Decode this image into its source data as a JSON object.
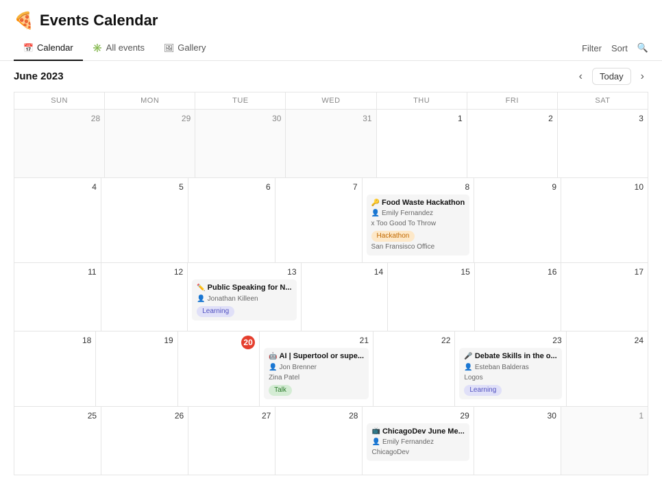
{
  "app": {
    "title": "Events Calendar",
    "logo": "🍕"
  },
  "tabs": {
    "items": [
      {
        "id": "calendar",
        "label": "Calendar",
        "icon": "📅",
        "active": true
      },
      {
        "id": "all-events",
        "label": "All events",
        "icon": "✳️",
        "active": false
      },
      {
        "id": "gallery",
        "label": "Gallery",
        "icon": "🖼",
        "active": false
      }
    ],
    "filter_label": "Filter",
    "sort_label": "Sort",
    "search_icon": "🔍"
  },
  "calendar": {
    "month_year": "June 2023",
    "today_label": "Today",
    "day_headers": [
      "Sun",
      "Mon",
      "Tue",
      "Wed",
      "Thu",
      "Fri",
      "Sat"
    ],
    "weeks": [
      {
        "days": [
          {
            "num": "28",
            "other_month": true,
            "events": []
          },
          {
            "num": "29",
            "other_month": true,
            "events": []
          },
          {
            "num": "30",
            "other_month": true,
            "events": []
          },
          {
            "num": "31",
            "other_month": true,
            "events": []
          },
          {
            "num": "Jun 1",
            "display_num": "1",
            "other_month": false,
            "events": []
          },
          {
            "num": "2",
            "other_month": false,
            "events": []
          },
          {
            "num": "3",
            "other_month": false,
            "events": []
          }
        ]
      },
      {
        "days": [
          {
            "num": "4",
            "other_month": false,
            "events": []
          },
          {
            "num": "5",
            "other_month": false,
            "events": []
          },
          {
            "num": "6",
            "other_month": false,
            "events": []
          },
          {
            "num": "7",
            "other_month": false,
            "events": []
          },
          {
            "num": "8",
            "other_month": false,
            "events": [
              {
                "title": "Food Waste Hackathon",
                "icon": "🔑",
                "organizer": "Emily Fernandez",
                "organizer_icon": "👤",
                "secondary": "x Too Good To Throw",
                "tag": "Hackathon",
                "tag_class": "tag-hackathon",
                "location": "San Fransisco Office"
              }
            ]
          },
          {
            "num": "9",
            "other_month": false,
            "events": []
          },
          {
            "num": "10",
            "other_month": false,
            "events": []
          }
        ]
      },
      {
        "days": [
          {
            "num": "11",
            "other_month": false,
            "events": []
          },
          {
            "num": "12",
            "other_month": false,
            "events": []
          },
          {
            "num": "13",
            "other_month": false,
            "events": [
              {
                "title": "Public Speaking for N...",
                "icon": "✏️",
                "organizer": "Jonathan Killeen",
                "organizer_icon": "👤",
                "tag": "Learning",
                "tag_class": "tag-learning"
              }
            ]
          },
          {
            "num": "14",
            "other_month": false,
            "events": []
          },
          {
            "num": "15",
            "other_month": false,
            "events": []
          },
          {
            "num": "16",
            "other_month": false,
            "events": []
          },
          {
            "num": "17",
            "other_month": false,
            "events": []
          }
        ]
      },
      {
        "days": [
          {
            "num": "18",
            "other_month": false,
            "events": []
          },
          {
            "num": "19",
            "other_month": false,
            "events": []
          },
          {
            "num": "20",
            "today": true,
            "other_month": false,
            "events": []
          },
          {
            "num": "21",
            "other_month": false,
            "events": [
              {
                "title": "AI | Supertool or supe...",
                "icon": "🤖",
                "organizer": "Jon Brenner",
                "organizer_icon": "👤",
                "secondary": "Zina Patel",
                "tag": "Talk",
                "tag_class": "tag-talk"
              }
            ]
          },
          {
            "num": "22",
            "other_month": false,
            "events": []
          },
          {
            "num": "23",
            "other_month": false,
            "events": [
              {
                "title": "Debate Skills in the o...",
                "icon": "🎤",
                "organizer": "Esteban Balderas",
                "organizer_icon": "👤",
                "secondary": "Logos",
                "tag": "Learning",
                "tag_class": "tag-learning"
              }
            ]
          },
          {
            "num": "24",
            "other_month": false,
            "events": []
          }
        ]
      },
      {
        "days": [
          {
            "num": "25",
            "other_month": false,
            "events": []
          },
          {
            "num": "26",
            "other_month": false,
            "events": []
          },
          {
            "num": "27",
            "other_month": false,
            "events": []
          },
          {
            "num": "28",
            "other_month": false,
            "events": []
          },
          {
            "num": "29",
            "other_month": false,
            "events": [
              {
                "title": "ChicagoDev June Me...",
                "icon": "📺",
                "organizer": "Emily Fernandez",
                "organizer_icon": "👤",
                "secondary": "ChicagoDev"
              }
            ]
          },
          {
            "num": "30",
            "other_month": false,
            "events": []
          },
          {
            "num": "Jul 1",
            "display_num": "1",
            "other_month": true,
            "events": []
          }
        ]
      }
    ]
  }
}
